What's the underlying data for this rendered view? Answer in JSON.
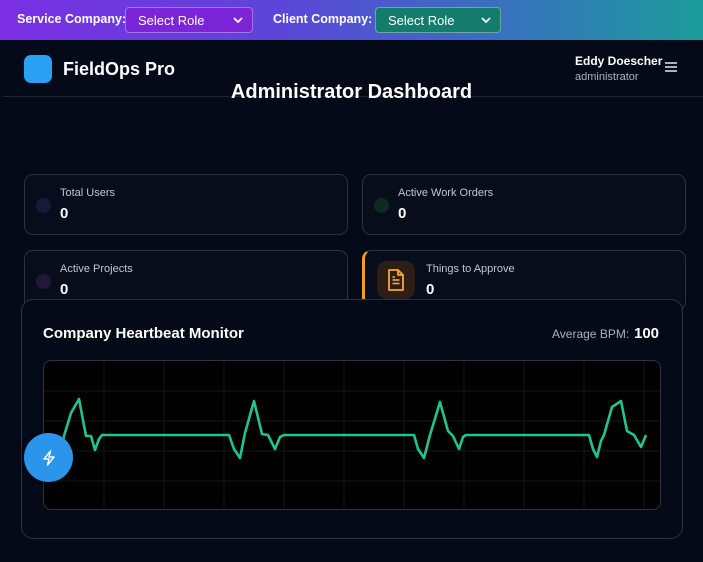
{
  "topbar": {
    "service_label": "Service Company:",
    "service_select": "Select Role",
    "client_label": "Client Company:",
    "client_select": "Select Role"
  },
  "header": {
    "brand": "FieldOps Pro",
    "user_name": "Eddy Doescher",
    "user_role": "administrator"
  },
  "page_title": "Administrator Dashboard",
  "cards": [
    {
      "label": "Total Users",
      "value": "0",
      "dot_color": "#151a3a"
    },
    {
      "label": "Active Work Orders",
      "value": "0",
      "dot_color": "#0f2a20"
    },
    {
      "label": "Active Projects",
      "value": "0",
      "dot_color": "#24163a"
    },
    {
      "label": "Things to Approve",
      "value": "0",
      "accent": "#f0a020"
    }
  ],
  "heartbeat": {
    "title": "Company Heartbeat Monitor",
    "avg_label": "Average BPM:",
    "avg_value": "100",
    "line_color": "#22c38e"
  }
}
